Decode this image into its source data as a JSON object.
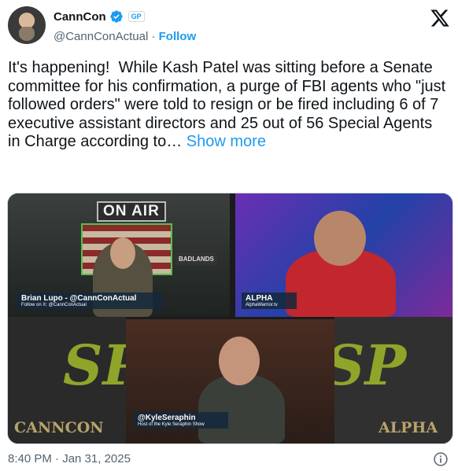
{
  "author": {
    "display_name": "CannCon",
    "handle": "@CannConActual",
    "separator": " · ",
    "follow_label": "Follow",
    "badge_label": "GP"
  },
  "tweet": {
    "text": "It's happening!  While Kash Patel was sitting before a Senate committee for his confirmation, a purge of FBI agents who \"just followed orders\" were told to resign or be fired including 6 of 7 executive assistant directors and 25 out of 56 Special Agents in Charge according to… ",
    "show_more": "Show more"
  },
  "media": {
    "on_air_sign": "ON AIR",
    "badlands": "BADLANDS",
    "panels": {
      "top_left": {
        "name": "Brian Lupo - @CannConActual",
        "sub": "Follow on X: @CannConActual"
      },
      "top_right": {
        "name": "ALPHA",
        "sub": "AlphaWarrior.tv"
      },
      "bottom_center": {
        "name": "@KyleSeraphin",
        "sub": "Host of the Kyle Seraphin Show"
      }
    },
    "logo_left": "SP",
    "logo_right": "SP",
    "corner_left": "CANNCON",
    "corner_right": "ALPHA"
  },
  "footer": {
    "timestamp": "8:40 PM · Jan 31, 2025"
  },
  "colors": {
    "accent": "#1d9bf0",
    "text": "#0f1419",
    "muted": "#536471"
  },
  "icons": [
    "verified-badge-icon",
    "x-logo-icon",
    "info-icon"
  ]
}
